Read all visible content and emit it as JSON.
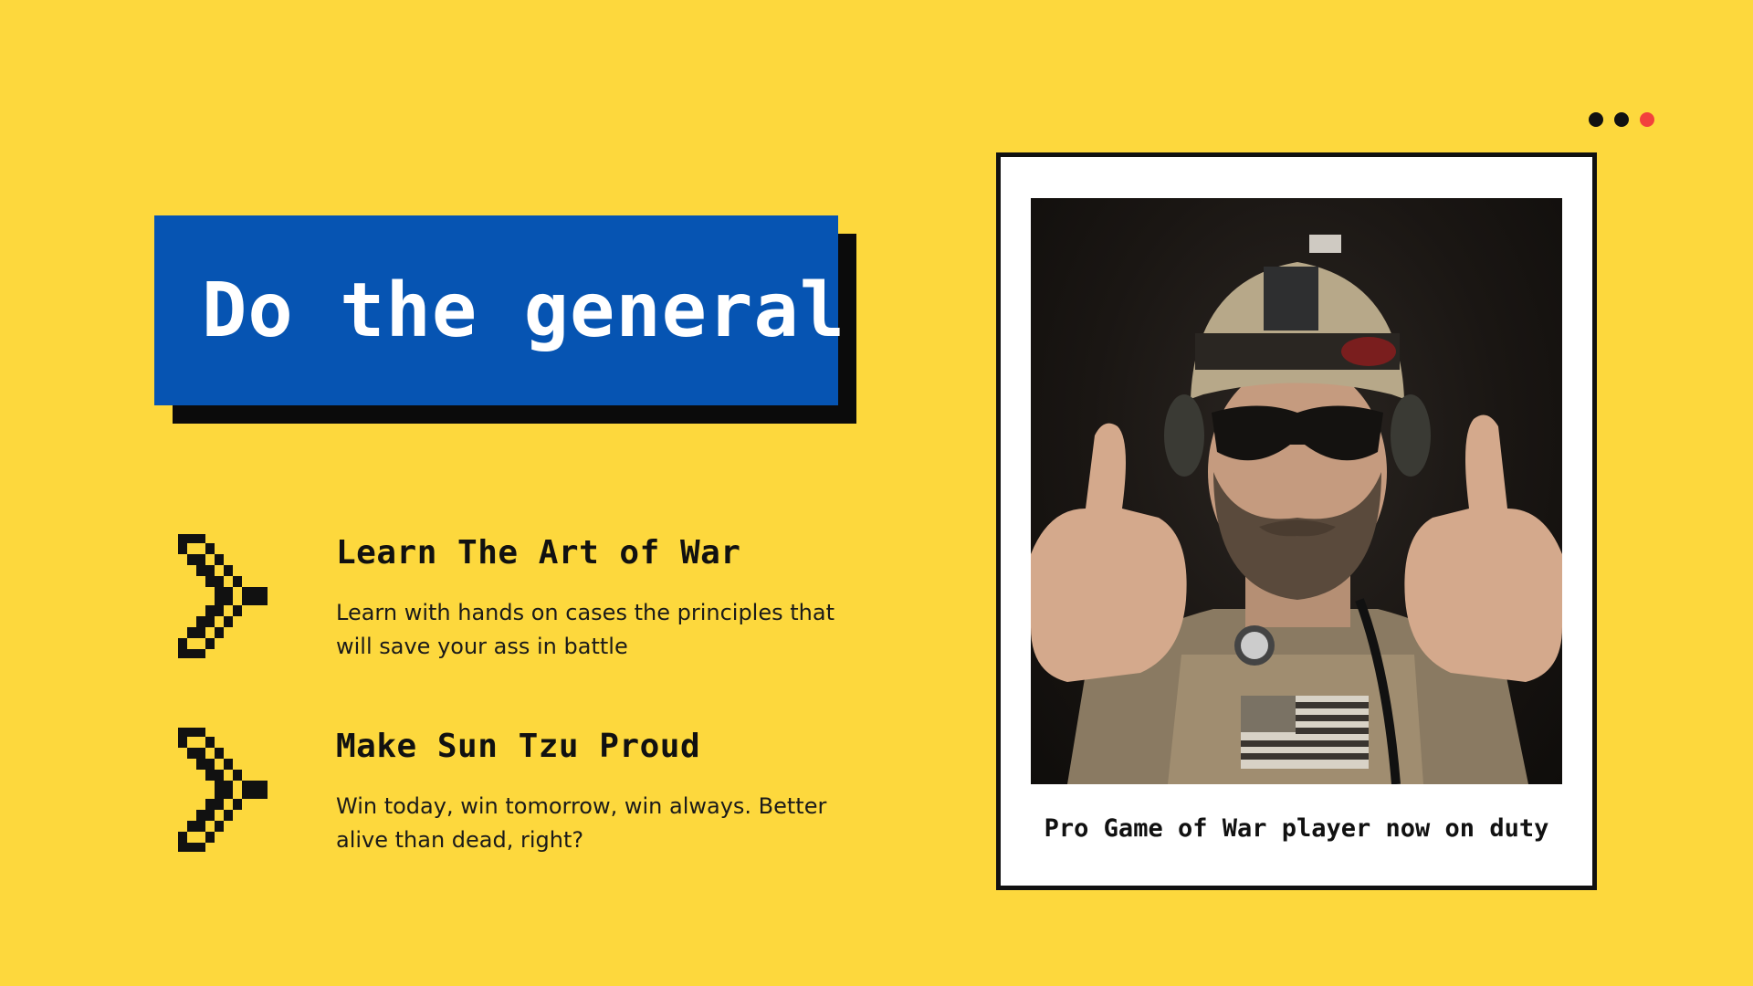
{
  "window_controls": {
    "dots": [
      "black",
      "black",
      "red"
    ],
    "colors": {
      "black": "#111111",
      "red": "#F2413D"
    }
  },
  "title": {
    "text": "Do the general",
    "bg_color": "#0654B2",
    "shadow_color": "#0B0B0B"
  },
  "features": [
    {
      "icon": "pixel-chevron-right-icon",
      "heading": "Learn The Art of War",
      "description": "Learn with hands on cases the principles that will save your ass in battle"
    },
    {
      "icon": "pixel-chevron-right-icon",
      "heading": "Make Sun Tzu Proud",
      "description": "Win today, win tomorrow, win always. Better alive than dead, right?"
    }
  ],
  "photo_card": {
    "image_subject": "soldier-thumbs-up-photo",
    "caption": "Pro Game of War player now on duty"
  },
  "theme": {
    "background": "#FDD83D",
    "text": "#111111"
  }
}
